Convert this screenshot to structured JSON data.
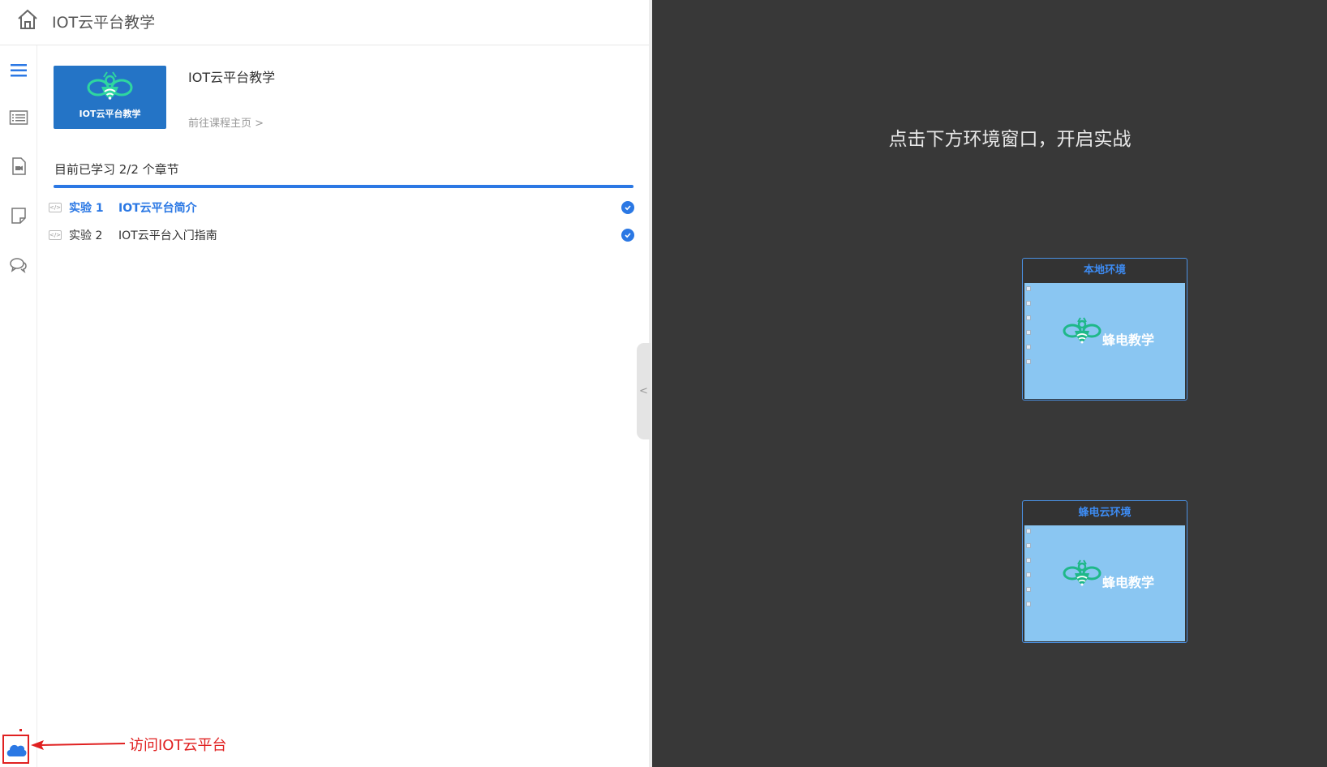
{
  "header": {
    "title": "IOT云平台教学",
    "home_icon": "home-icon"
  },
  "rail": {
    "icons": [
      "menu-icon",
      "list-icon",
      "video-doc-icon",
      "note-icon",
      "chat-icon"
    ],
    "bottom_icon": "cloud-icon"
  },
  "course": {
    "thumb_label": "IOT云平台教学",
    "title": "IOT云平台教学",
    "link": "前往课程主页 >"
  },
  "progress": {
    "text": "目前已学习 2/2 个章节",
    "fraction": 1.0
  },
  "lessons": [
    {
      "num": "实验 1",
      "name": "IOT云平台简介",
      "active": true,
      "done": true
    },
    {
      "num": "实验 2",
      "name": "IOT云平台入门指南",
      "active": false,
      "done": true
    }
  ],
  "handle": {
    "label": "<"
  },
  "right": {
    "prompt": "点击下方环境窗口，开启实战",
    "envs": [
      {
        "title": "本地环境",
        "logo_text": "蜂电教学"
      },
      {
        "title": "蜂电云环境",
        "logo_text": "蜂电教学"
      }
    ]
  },
  "annotation": {
    "text": "访问IOT云平台"
  },
  "colors": {
    "accent": "#2b78e4",
    "dark_bg": "#383838",
    "annotation": "#e02020",
    "env_screen": "#8ac6f2"
  }
}
